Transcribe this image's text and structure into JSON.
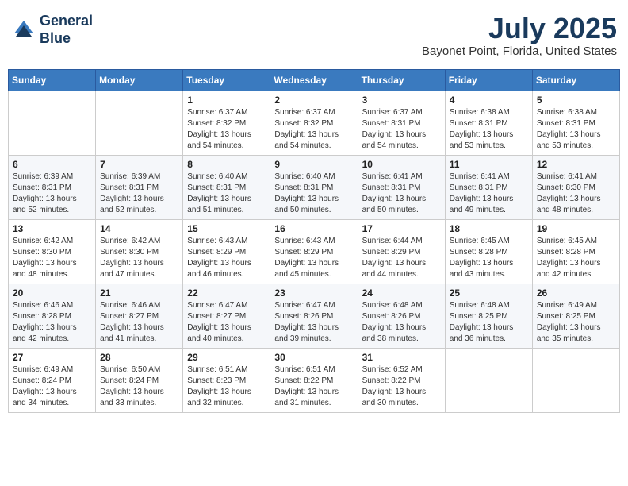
{
  "header": {
    "logo_line1": "General",
    "logo_line2": "Blue",
    "month": "July 2025",
    "location": "Bayonet Point, Florida, United States"
  },
  "days_of_week": [
    "Sunday",
    "Monday",
    "Tuesday",
    "Wednesday",
    "Thursday",
    "Friday",
    "Saturday"
  ],
  "weeks": [
    [
      {
        "day": "",
        "info": ""
      },
      {
        "day": "",
        "info": ""
      },
      {
        "day": "1",
        "info": "Sunrise: 6:37 AM\nSunset: 8:32 PM\nDaylight: 13 hours and 54 minutes."
      },
      {
        "day": "2",
        "info": "Sunrise: 6:37 AM\nSunset: 8:32 PM\nDaylight: 13 hours and 54 minutes."
      },
      {
        "day": "3",
        "info": "Sunrise: 6:37 AM\nSunset: 8:31 PM\nDaylight: 13 hours and 54 minutes."
      },
      {
        "day": "4",
        "info": "Sunrise: 6:38 AM\nSunset: 8:31 PM\nDaylight: 13 hours and 53 minutes."
      },
      {
        "day": "5",
        "info": "Sunrise: 6:38 AM\nSunset: 8:31 PM\nDaylight: 13 hours and 53 minutes."
      }
    ],
    [
      {
        "day": "6",
        "info": "Sunrise: 6:39 AM\nSunset: 8:31 PM\nDaylight: 13 hours and 52 minutes."
      },
      {
        "day": "7",
        "info": "Sunrise: 6:39 AM\nSunset: 8:31 PM\nDaylight: 13 hours and 52 minutes."
      },
      {
        "day": "8",
        "info": "Sunrise: 6:40 AM\nSunset: 8:31 PM\nDaylight: 13 hours and 51 minutes."
      },
      {
        "day": "9",
        "info": "Sunrise: 6:40 AM\nSunset: 8:31 PM\nDaylight: 13 hours and 50 minutes."
      },
      {
        "day": "10",
        "info": "Sunrise: 6:41 AM\nSunset: 8:31 PM\nDaylight: 13 hours and 50 minutes."
      },
      {
        "day": "11",
        "info": "Sunrise: 6:41 AM\nSunset: 8:31 PM\nDaylight: 13 hours and 49 minutes."
      },
      {
        "day": "12",
        "info": "Sunrise: 6:41 AM\nSunset: 8:30 PM\nDaylight: 13 hours and 48 minutes."
      }
    ],
    [
      {
        "day": "13",
        "info": "Sunrise: 6:42 AM\nSunset: 8:30 PM\nDaylight: 13 hours and 48 minutes."
      },
      {
        "day": "14",
        "info": "Sunrise: 6:42 AM\nSunset: 8:30 PM\nDaylight: 13 hours and 47 minutes."
      },
      {
        "day": "15",
        "info": "Sunrise: 6:43 AM\nSunset: 8:29 PM\nDaylight: 13 hours and 46 minutes."
      },
      {
        "day": "16",
        "info": "Sunrise: 6:43 AM\nSunset: 8:29 PM\nDaylight: 13 hours and 45 minutes."
      },
      {
        "day": "17",
        "info": "Sunrise: 6:44 AM\nSunset: 8:29 PM\nDaylight: 13 hours and 44 minutes."
      },
      {
        "day": "18",
        "info": "Sunrise: 6:45 AM\nSunset: 8:28 PM\nDaylight: 13 hours and 43 minutes."
      },
      {
        "day": "19",
        "info": "Sunrise: 6:45 AM\nSunset: 8:28 PM\nDaylight: 13 hours and 42 minutes."
      }
    ],
    [
      {
        "day": "20",
        "info": "Sunrise: 6:46 AM\nSunset: 8:28 PM\nDaylight: 13 hours and 42 minutes."
      },
      {
        "day": "21",
        "info": "Sunrise: 6:46 AM\nSunset: 8:27 PM\nDaylight: 13 hours and 41 minutes."
      },
      {
        "day": "22",
        "info": "Sunrise: 6:47 AM\nSunset: 8:27 PM\nDaylight: 13 hours and 40 minutes."
      },
      {
        "day": "23",
        "info": "Sunrise: 6:47 AM\nSunset: 8:26 PM\nDaylight: 13 hours and 39 minutes."
      },
      {
        "day": "24",
        "info": "Sunrise: 6:48 AM\nSunset: 8:26 PM\nDaylight: 13 hours and 38 minutes."
      },
      {
        "day": "25",
        "info": "Sunrise: 6:48 AM\nSunset: 8:25 PM\nDaylight: 13 hours and 36 minutes."
      },
      {
        "day": "26",
        "info": "Sunrise: 6:49 AM\nSunset: 8:25 PM\nDaylight: 13 hours and 35 minutes."
      }
    ],
    [
      {
        "day": "27",
        "info": "Sunrise: 6:49 AM\nSunset: 8:24 PM\nDaylight: 13 hours and 34 minutes."
      },
      {
        "day": "28",
        "info": "Sunrise: 6:50 AM\nSunset: 8:24 PM\nDaylight: 13 hours and 33 minutes."
      },
      {
        "day": "29",
        "info": "Sunrise: 6:51 AM\nSunset: 8:23 PM\nDaylight: 13 hours and 32 minutes."
      },
      {
        "day": "30",
        "info": "Sunrise: 6:51 AM\nSunset: 8:22 PM\nDaylight: 13 hours and 31 minutes."
      },
      {
        "day": "31",
        "info": "Sunrise: 6:52 AM\nSunset: 8:22 PM\nDaylight: 13 hours and 30 minutes."
      },
      {
        "day": "",
        "info": ""
      },
      {
        "day": "",
        "info": ""
      }
    ]
  ]
}
